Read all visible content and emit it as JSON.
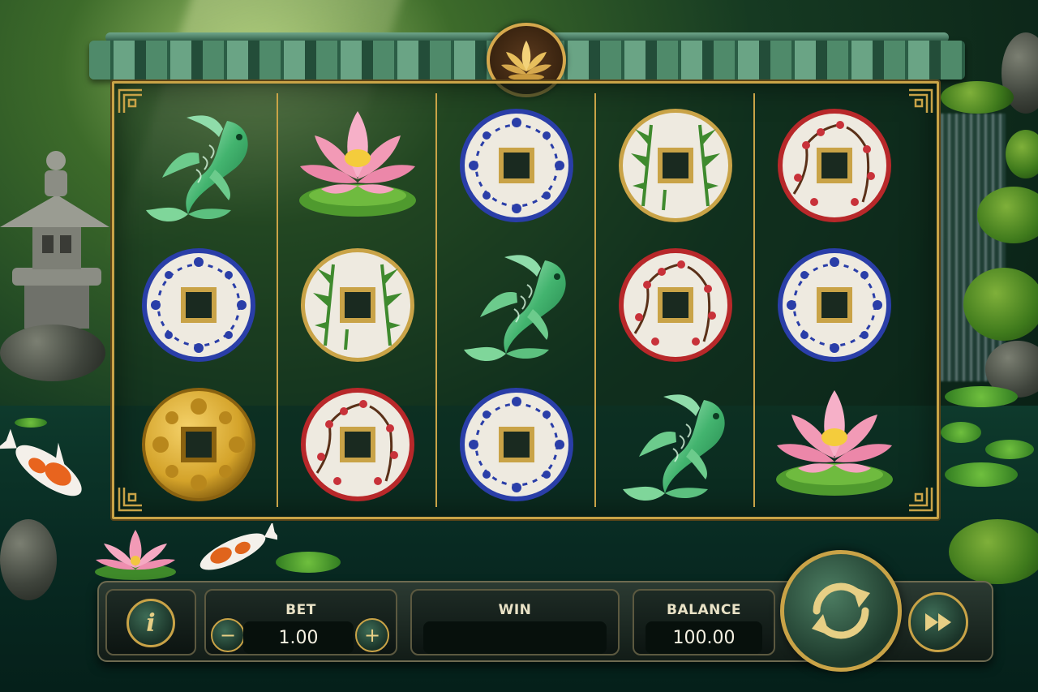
{
  "controls": {
    "bet_label": "BET",
    "bet_value": "1.00",
    "win_label": "WIN",
    "win_value": "",
    "balance_label": "BALANCE",
    "balance_value": "100.00",
    "decrease_label": "−",
    "increase_label": "+",
    "info_label": "i"
  },
  "reels": [
    [
      "jade-koi",
      "blue-floral-coin",
      "gold-floral-coin"
    ],
    [
      "pink-lotus",
      "bamboo-coin",
      "plum-blossom-coin"
    ],
    [
      "blue-floral-coin",
      "jade-koi",
      "blue-floral-coin"
    ],
    [
      "bamboo-coin",
      "plum-blossom-coin",
      "jade-koi"
    ],
    [
      "plum-blossom-coin",
      "blue-floral-coin",
      "pink-lotus"
    ]
  ],
  "colors": {
    "frame_gold": "#c9a347",
    "jade": "#3fae6a",
    "coin_blue": "#2a3ea8",
    "coin_red": "#b8282a",
    "coin_green": "#3f8a2e",
    "coin_gold": "#d4a32a",
    "lotus_pink": "#f29ab6"
  },
  "icons": {
    "info": "info-icon",
    "minus": "minus-icon",
    "plus": "plus-icon",
    "spin": "spin-arrows-icon",
    "fast_forward": "fast-forward-icon",
    "emblem": "lotus-emblem-icon"
  }
}
